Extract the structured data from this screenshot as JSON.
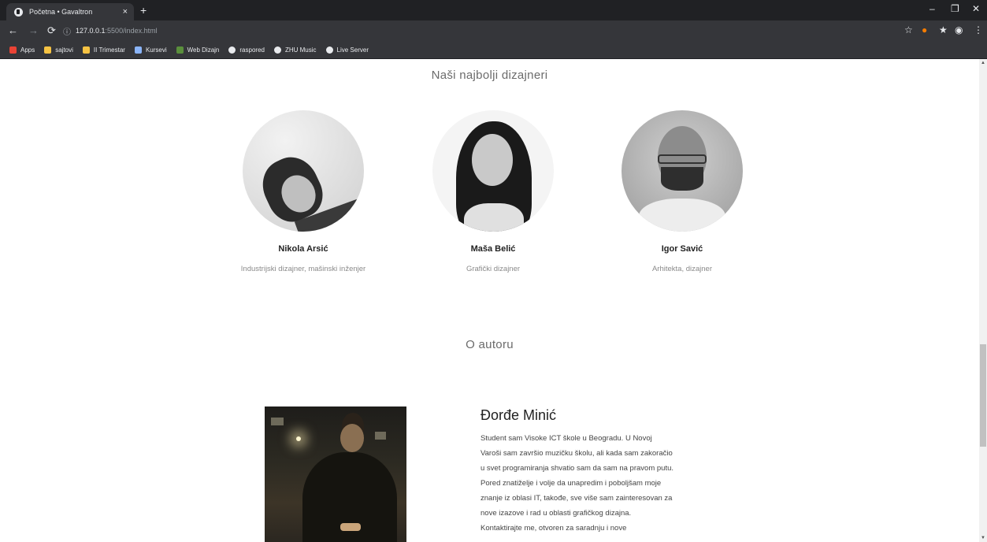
{
  "browser": {
    "tab_title": "Početna • Gavaltron",
    "tab_close": "×",
    "new_tab": "+",
    "url_host": "127.0.0.1",
    "url_path": ":5500/index.html",
    "bookmarks": [
      {
        "label": "Apps",
        "color": "#ea4335"
      },
      {
        "label": "sajtovi",
        "color": "#f6c343"
      },
      {
        "label": "II Trimestar",
        "color": "#f6c343"
      },
      {
        "label": "Kursevi",
        "color": "#8ab4f8"
      },
      {
        "label": "Web Dizajn",
        "color": "#5a8f3c"
      },
      {
        "label": "raspored",
        "color": "#e8eaed"
      },
      {
        "label": "ZHU Music",
        "color": "#e8eaed"
      },
      {
        "label": "Live Server",
        "color": "#e8eaed"
      }
    ]
  },
  "designers": {
    "heading": "Naši najbolji dizajneri",
    "items": [
      {
        "name": "Nikola Arsić",
        "role": "Industrijski dizajner, mašinski inženjer"
      },
      {
        "name": "Maša Belić",
        "role": "Grafički dizajner"
      },
      {
        "name": "Igor Savić",
        "role": "Arhitekta, dizajner"
      }
    ]
  },
  "author": {
    "heading": "O autoru",
    "name": "Đorđe Minić",
    "bio": "Student sam Visoke ICT škole u Beogradu. U Novoj Varoši sam završio muzičku školu, ali kada sam zakoračio u svet programiranja shvatio sam da sam na pravom putu. Pored znatiželje i volje da unapredim i poboljšam moje znanje iz oblasi IT, takođe, sve više sam zainteresovan za nove izazove i rad u oblasti grafičkog dizajna. Kontaktirajte me, otvoren za saradnju i nove"
  }
}
